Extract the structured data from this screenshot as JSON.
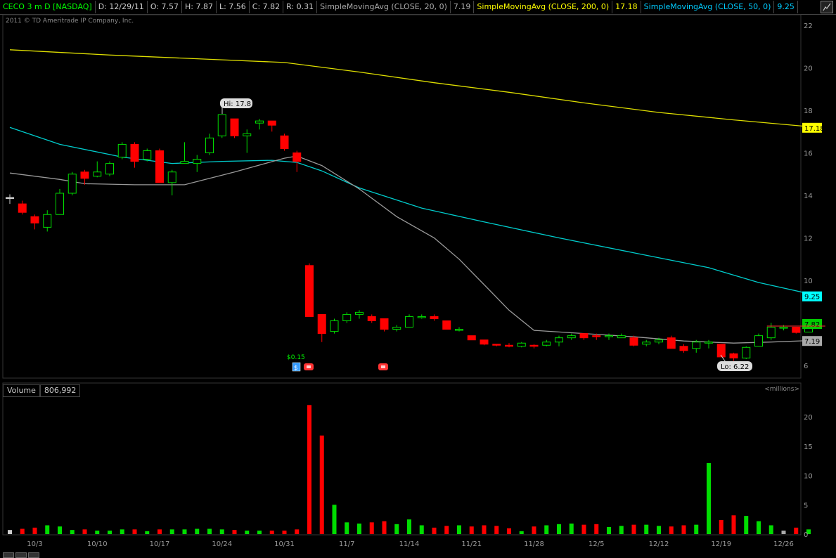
{
  "header": {
    "symbol": "CECO 3 m D [NASDAQ]",
    "date": "D: 12/29/11",
    "open": "O: 7.57",
    "high": "H: 7.87",
    "low": "L: 7.56",
    "close": "C: 7.82",
    "range": "R: 0.31",
    "sma20_label": "SimpleMovingAvg (CLOSE, 20, 0)",
    "sma20_value": "7.19",
    "sma200_label": "SimpleMovingAvg (CLOSE, 200, 0)",
    "sma200_value": "17.18",
    "sma50_label": "SimpleMovingAvg (CLOSE, 50, 0)",
    "sma50_value": "9.25"
  },
  "copyright": "2011 © TD Ameritrade IP Company, Inc.",
  "volume_panel": {
    "label": "Volume",
    "value": "806,992",
    "units": "<millions>"
  },
  "colors": {
    "up": "#00dd00",
    "down": "#ff0000",
    "sma20": "#999999",
    "sma50": "#00cccc",
    "sma200": "#dddd00",
    "background": "#000000"
  },
  "chart_data": {
    "type": "candlestick",
    "price_axis": {
      "ylim": [
        5.6,
        22.5
      ],
      "ticks": [
        6,
        8,
        10,
        12,
        14,
        16,
        18,
        20,
        22
      ]
    },
    "volume_axis": {
      "ylim": [
        0,
        24
      ],
      "ticks": [
        0,
        5,
        10,
        15,
        20
      ]
    },
    "x_tick_labels": [
      "10/3",
      "10/10",
      "10/17",
      "10/24",
      "10/31",
      "11/7",
      "11/14",
      "11/21",
      "11/28",
      "12/5",
      "12/12",
      "12/19",
      "12/26"
    ],
    "annotations": {
      "hi": "Hi: 17.8",
      "lo": "Lo: 6.22",
      "dividend": "$0.15"
    },
    "price_labels": [
      {
        "name": "sma200",
        "value": 17.18,
        "text": "17.18"
      },
      {
        "name": "sma50",
        "value": 9.25,
        "text": "9.25"
      },
      {
        "name": "close",
        "value": 7.82,
        "text": "7.82"
      },
      {
        "name": "sma20",
        "value": 7.19,
        "text": "7.19"
      }
    ],
    "candles": [
      {
        "o": 13.9,
        "h": 14.05,
        "l": 13.6,
        "c": 13.9,
        "v": 0.7
      },
      {
        "o": 13.6,
        "h": 13.75,
        "l": 13.1,
        "c": 13.2,
        "v": 0.9
      },
      {
        "o": 13.0,
        "h": 13.1,
        "l": 12.4,
        "c": 12.7,
        "v": 1.1
      },
      {
        "o": 12.5,
        "h": 13.3,
        "l": 12.3,
        "c": 13.1,
        "v": 1.5
      },
      {
        "o": 13.1,
        "h": 14.3,
        "l": 13.1,
        "c": 14.1,
        "v": 1.3
      },
      {
        "o": 14.1,
        "h": 15.1,
        "l": 14.0,
        "c": 15.0,
        "v": 0.7
      },
      {
        "o": 15.1,
        "h": 15.2,
        "l": 14.5,
        "c": 14.8,
        "v": 0.8
      },
      {
        "o": 14.9,
        "h": 15.6,
        "l": 14.85,
        "c": 15.1,
        "v": 0.6
      },
      {
        "o": 15.0,
        "h": 15.6,
        "l": 14.9,
        "c": 15.5,
        "v": 0.6
      },
      {
        "o": 15.8,
        "h": 16.5,
        "l": 15.7,
        "c": 16.4,
        "v": 0.8
      },
      {
        "o": 16.4,
        "h": 16.5,
        "l": 15.3,
        "c": 15.6,
        "v": 0.8
      },
      {
        "o": 15.7,
        "h": 16.2,
        "l": 15.6,
        "c": 16.1,
        "v": 0.5
      },
      {
        "o": 16.1,
        "h": 16.2,
        "l": 14.6,
        "c": 14.6,
        "v": 0.8
      },
      {
        "o": 14.6,
        "h": 15.2,
        "l": 14.0,
        "c": 15.1,
        "v": 0.8
      },
      {
        "o": 15.5,
        "h": 16.5,
        "l": 15.5,
        "c": 15.6,
        "v": 0.8
      },
      {
        "o": 15.5,
        "h": 15.9,
        "l": 15.1,
        "c": 15.7,
        "v": 0.9
      },
      {
        "o": 16.0,
        "h": 16.9,
        "l": 15.9,
        "c": 16.7,
        "v": 0.9
      },
      {
        "o": 16.8,
        "h": 17.8,
        "l": 16.7,
        "c": 17.8,
        "v": 0.8
      },
      {
        "o": 17.6,
        "h": 17.6,
        "l": 16.7,
        "c": 16.8,
        "v": 0.7
      },
      {
        "o": 16.8,
        "h": 17.1,
        "l": 16.0,
        "c": 16.9,
        "v": 0.6
      },
      {
        "o": 17.4,
        "h": 17.6,
        "l": 17.1,
        "c": 17.5,
        "v": 0.6
      },
      {
        "o": 17.5,
        "h": 17.5,
        "l": 17.0,
        "c": 17.3,
        "v": 0.6
      },
      {
        "o": 16.8,
        "h": 16.9,
        "l": 16.1,
        "c": 16.2,
        "v": 0.6
      },
      {
        "o": 16.0,
        "h": 16.1,
        "l": 15.1,
        "c": 15.6,
        "v": 0.8
      },
      {
        "o": 10.7,
        "h": 10.8,
        "l": 8.3,
        "c": 8.3,
        "v": 22.0
      },
      {
        "o": 8.4,
        "h": 8.4,
        "l": 7.1,
        "c": 7.5,
        "v": 16.8
      },
      {
        "o": 7.6,
        "h": 8.2,
        "l": 7.5,
        "c": 8.1,
        "v": 5.0
      },
      {
        "o": 8.1,
        "h": 8.5,
        "l": 8.0,
        "c": 8.4,
        "v": 2.0
      },
      {
        "o": 8.4,
        "h": 8.6,
        "l": 8.2,
        "c": 8.5,
        "v": 1.8
      },
      {
        "o": 8.3,
        "h": 8.4,
        "l": 8.0,
        "c": 8.1,
        "v": 2.0
      },
      {
        "o": 8.2,
        "h": 8.2,
        "l": 7.6,
        "c": 7.7,
        "v": 2.2
      },
      {
        "o": 7.7,
        "h": 7.9,
        "l": 7.6,
        "c": 7.8,
        "v": 1.7
      },
      {
        "o": 7.8,
        "h": 8.4,
        "l": 7.8,
        "c": 8.3,
        "v": 2.5
      },
      {
        "o": 8.3,
        "h": 8.4,
        "l": 8.2,
        "c": 8.3,
        "v": 1.5
      },
      {
        "o": 8.3,
        "h": 8.4,
        "l": 8.1,
        "c": 8.2,
        "v": 1.1
      },
      {
        "o": 8.1,
        "h": 8.1,
        "l": 7.7,
        "c": 7.7,
        "v": 1.4
      },
      {
        "o": 7.7,
        "h": 7.8,
        "l": 7.6,
        "c": 7.7,
        "v": 1.5
      },
      {
        "o": 7.4,
        "h": 7.4,
        "l": 7.2,
        "c": 7.2,
        "v": 1.3
      },
      {
        "o": 7.2,
        "h": 7.2,
        "l": 6.95,
        "c": 7.0,
        "v": 1.5
      },
      {
        "o": 7.0,
        "h": 7.0,
        "l": 6.9,
        "c": 6.95,
        "v": 1.4
      },
      {
        "o": 6.95,
        "h": 7.05,
        "l": 6.85,
        "c": 6.9,
        "v": 1.0
      },
      {
        "o": 6.9,
        "h": 7.1,
        "l": 6.85,
        "c": 7.05,
        "v": 0.5
      },
      {
        "o": 6.95,
        "h": 7.0,
        "l": 6.8,
        "c": 6.9,
        "v": 1.3
      },
      {
        "o": 6.95,
        "h": 7.2,
        "l": 6.9,
        "c": 7.1,
        "v": 1.5
      },
      {
        "o": 7.1,
        "h": 7.4,
        "l": 6.9,
        "c": 7.3,
        "v": 1.7
      },
      {
        "o": 7.3,
        "h": 7.5,
        "l": 7.2,
        "c": 7.4,
        "v": 1.8
      },
      {
        "o": 7.5,
        "h": 7.5,
        "l": 7.2,
        "c": 7.3,
        "v": 1.6
      },
      {
        "o": 7.4,
        "h": 7.5,
        "l": 7.2,
        "c": 7.35,
        "v": 1.7
      },
      {
        "o": 7.35,
        "h": 7.5,
        "l": 7.2,
        "c": 7.4,
        "v": 1.2
      },
      {
        "o": 7.3,
        "h": 7.5,
        "l": 7.3,
        "c": 7.4,
        "v": 1.4
      },
      {
        "o": 7.3,
        "h": 7.4,
        "l": 6.9,
        "c": 6.95,
        "v": 1.6
      },
      {
        "o": 7.0,
        "h": 7.2,
        "l": 6.9,
        "c": 7.1,
        "v": 1.6
      },
      {
        "o": 7.1,
        "h": 7.3,
        "l": 7.0,
        "c": 7.2,
        "v": 1.4
      },
      {
        "o": 7.3,
        "h": 7.4,
        "l": 6.8,
        "c": 6.8,
        "v": 1.3
      },
      {
        "o": 6.9,
        "h": 7.0,
        "l": 6.6,
        "c": 6.7,
        "v": 1.5
      },
      {
        "o": 6.8,
        "h": 7.2,
        "l": 6.6,
        "c": 7.1,
        "v": 1.6
      },
      {
        "o": 7.1,
        "h": 7.2,
        "l": 6.8,
        "c": 7.1,
        "v": 12.1
      },
      {
        "o": 7.0,
        "h": 7.0,
        "l": 6.4,
        "c": 6.4,
        "v": 2.4
      },
      {
        "o": 6.55,
        "h": 6.6,
        "l": 6.22,
        "c": 6.35,
        "v": 3.2
      },
      {
        "o": 6.35,
        "h": 6.9,
        "l": 6.3,
        "c": 6.85,
        "v": 3.1
      },
      {
        "o": 6.9,
        "h": 7.5,
        "l": 6.9,
        "c": 7.4,
        "v": 2.2
      },
      {
        "o": 7.3,
        "h": 8.0,
        "l": 7.2,
        "c": 7.8,
        "v": 1.5
      },
      {
        "o": 7.75,
        "h": 7.9,
        "l": 7.65,
        "c": 7.8,
        "v": 0.6
      },
      {
        "o": 7.8,
        "h": 7.8,
        "l": 7.5,
        "c": 7.55,
        "v": 1.1
      },
      {
        "o": 7.57,
        "h": 7.87,
        "l": 7.56,
        "c": 7.82,
        "v": 0.8
      }
    ],
    "sma20": [
      [
        0,
        15.05
      ],
      [
        4,
        14.75
      ],
      [
        6,
        14.55
      ],
      [
        10,
        14.5
      ],
      [
        14,
        14.5
      ],
      [
        18,
        15.1
      ],
      [
        22,
        15.75
      ],
      [
        23,
        15.85
      ],
      [
        25,
        15.4
      ],
      [
        28,
        14.3
      ],
      [
        31,
        13.0
      ],
      [
        34,
        12.0
      ],
      [
        36,
        11.0
      ],
      [
        38,
        9.8
      ],
      [
        40,
        8.6
      ],
      [
        42,
        7.65
      ],
      [
        46,
        7.5
      ],
      [
        50,
        7.35
      ],
      [
        54,
        7.15
      ],
      [
        58,
        7.05
      ],
      [
        61,
        7.1
      ],
      [
        65,
        7.19
      ]
    ],
    "sma50": [
      [
        0,
        17.2
      ],
      [
        4,
        16.4
      ],
      [
        9,
        15.8
      ],
      [
        13,
        15.5
      ],
      [
        17,
        15.6
      ],
      [
        21,
        15.65
      ],
      [
        23,
        15.55
      ],
      [
        25,
        15.15
      ],
      [
        28,
        14.35
      ],
      [
        33,
        13.4
      ],
      [
        38,
        12.75
      ],
      [
        44,
        12.0
      ],
      [
        50,
        11.3
      ],
      [
        56,
        10.6
      ],
      [
        60,
        9.9
      ],
      [
        65,
        9.25
      ]
    ],
    "sma200": [
      [
        0,
        20.85
      ],
      [
        8,
        20.6
      ],
      [
        16,
        20.4
      ],
      [
        22,
        20.25
      ],
      [
        28,
        19.8
      ],
      [
        34,
        19.3
      ],
      [
        40,
        18.85
      ],
      [
        46,
        18.35
      ],
      [
        52,
        17.9
      ],
      [
        58,
        17.55
      ],
      [
        65,
        17.18
      ]
    ]
  }
}
